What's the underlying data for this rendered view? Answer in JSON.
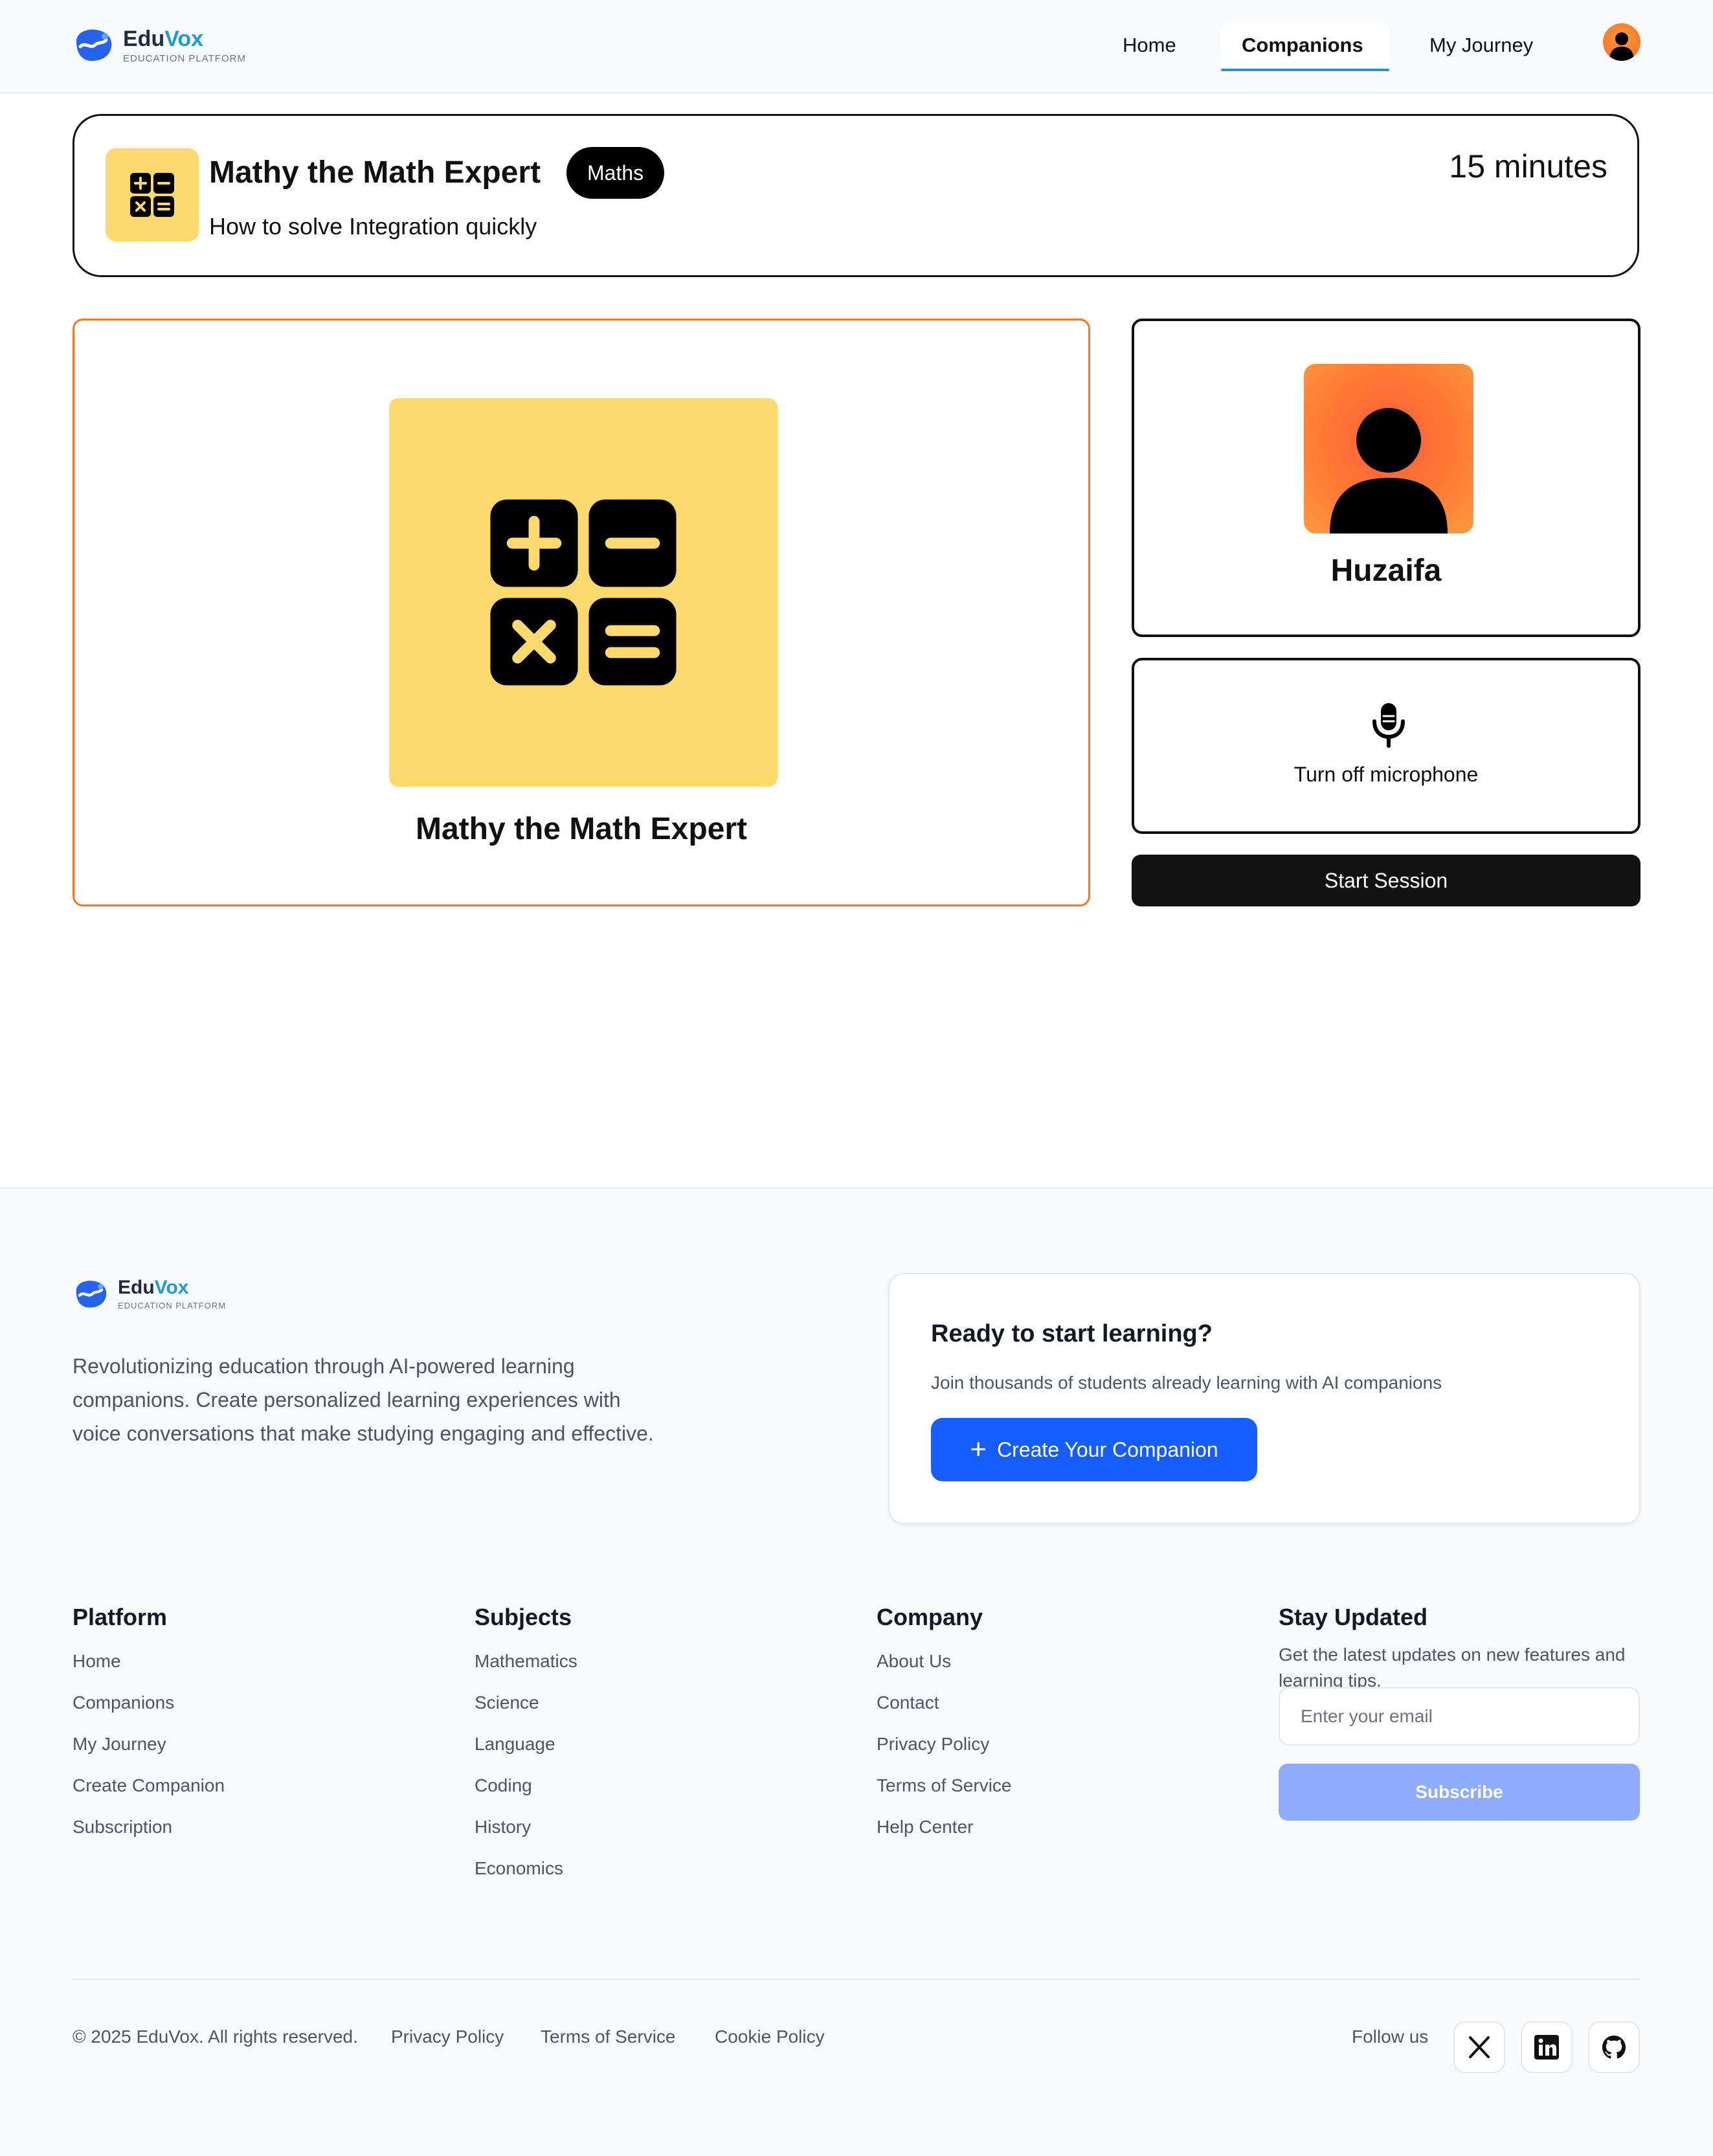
{
  "header": {
    "logo": {
      "name_part1": "Edu",
      "name_part2": "Vox",
      "tagline": "EDUCATION PLATFORM"
    },
    "nav": [
      {
        "label": "Home",
        "active": false
      },
      {
        "label": "Companions",
        "active": true
      },
      {
        "label": "My Journey",
        "active": false
      }
    ],
    "avatar_icon": "user-avatar-icon"
  },
  "companion": {
    "name": "Mathy the Math Expert",
    "subject": "Maths",
    "topic": "How to solve Integration quickly",
    "duration": "15 minutes",
    "icon": "calculator-icon",
    "icon_bg": "#fdd96e"
  },
  "user": {
    "name": "Huzaifa",
    "avatar_icon": "user-avatar-icon"
  },
  "session": {
    "mic_label": "Turn off microphone",
    "mic_icon": "microphone-icon",
    "start_label": "Start Session"
  },
  "footer": {
    "logo": {
      "name_part1": "Edu",
      "name_part2": "Vox",
      "tagline": "EDUCATION PLATFORM"
    },
    "description": "Revolutionizing education through AI-powered learning companions. Create personalized learning experiences with voice conversations that make studying engaging and effective.",
    "cta": {
      "title": "Ready to start learning?",
      "subtitle": "Join thousands of students already learning with AI companions",
      "button_label": "Create Your Companion",
      "button_icon": "plus-icon"
    },
    "columns": {
      "platform": {
        "title": "Platform",
        "links": [
          "Home",
          "Companions",
          "My Journey",
          "Create Companion",
          "Subscription"
        ]
      },
      "subjects": {
        "title": "Subjects",
        "links": [
          "Mathematics",
          "Science",
          "Language",
          "Coding",
          "History",
          "Economics"
        ]
      },
      "company": {
        "title": "Company",
        "links": [
          "About Us",
          "Contact",
          "Privacy Policy",
          "Terms of Service",
          "Help Center"
        ]
      }
    },
    "stay_updated": {
      "title": "Stay Updated",
      "description": "Get the latest updates on new features and learning tips.",
      "email_placeholder": "Enter your email",
      "subscribe_label": "Subscribe"
    },
    "bottom": {
      "copyright": "© 2025 EduVox. All rights reserved.",
      "links": [
        "Privacy Policy",
        "Terms of Service",
        "Cookie Policy"
      ],
      "follow_label": "Follow us",
      "social": [
        "x-icon",
        "linkedin-icon",
        "github-icon"
      ]
    }
  },
  "colors": {
    "accent_orange": "#f07a23",
    "primary_blue": "#155dfc",
    "subscribe_blue": "#8eacfb",
    "nav_underline": "#2b8fd6",
    "logo_accent": "#1e9ad6"
  }
}
